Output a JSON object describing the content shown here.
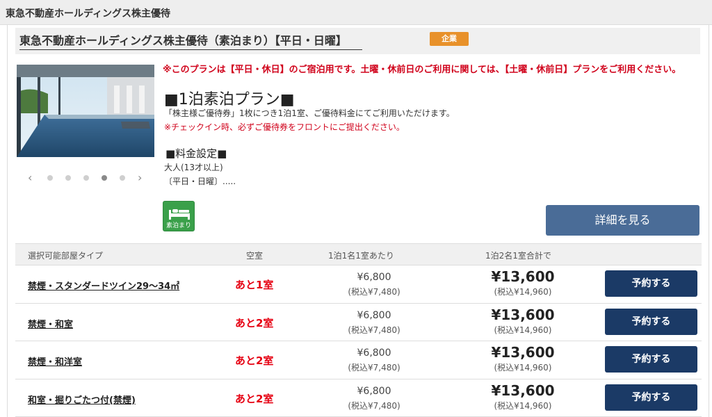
{
  "header": {
    "title": "東急不動産ホールディングス株主優待"
  },
  "plan": {
    "title": "東急不動産ホールディングス株主優待（素泊まり）【平日・日曜】",
    "badge": "企業",
    "notice": "※このプランは【平日・休日】のご宿泊用です。土曜・休前日のご利用に関しては、【土曜・休前日】プランをご利用ください。",
    "name": "■1泊素泊プラン■",
    "desc_line1": "「株主様ご優待券」1枚につき1泊1室、ご優待料金にてご利用いただけます。",
    "desc_line2": "※チェックイン時、必ずご優待券をフロントにご提出ください。",
    "price_heading": "■料金設定■",
    "adult": "大人(13才以上)",
    "days": "〔平日・日曜〕.....",
    "room_only_label": "素泊まり",
    "detail_button": "詳細を見る",
    "carousel": {
      "total": 5,
      "active": 4
    }
  },
  "rooms": {
    "headers": {
      "type": "選択可能部屋タイプ",
      "availability": "空室",
      "per_person": "1泊1名1室あたり",
      "total": "1泊2名1室合計で"
    },
    "rows": [
      {
        "name": "禁煙・スタンダードツイン29～34㎡",
        "availability": "あと1室",
        "price": "¥6,800",
        "price_tax": "(税込¥7,480)",
        "total": "¥13,600",
        "total_tax": "(税込¥14,960)",
        "book": "予約する"
      },
      {
        "name": "禁煙・和室",
        "availability": "あと2室",
        "price": "¥6,800",
        "price_tax": "(税込¥7,480)",
        "total": "¥13,600",
        "total_tax": "(税込¥14,960)",
        "book": "予約する"
      },
      {
        "name": "禁煙・和洋室",
        "availability": "あと2室",
        "price": "¥6,800",
        "price_tax": "(税込¥7,480)",
        "total": "¥13,600",
        "total_tax": "(税込¥14,960)",
        "book": "予約する"
      },
      {
        "name": "和室・掘りごたつ付(禁煙)",
        "availability": "あと2室",
        "price": "¥6,800",
        "price_tax": "(税込¥7,480)",
        "total": "¥13,600",
        "total_tax": "(税込¥14,960)",
        "book": "予約する"
      }
    ]
  },
  "colors": {
    "badge": "#e8912a",
    "alert_red": "#d0021b",
    "detail_button": "#4a6c97",
    "book_button": "#1b3a66",
    "room_only_icon": "#3aa04a"
  },
  "icons": {
    "prev": "chevron-left-icon",
    "next": "chevron-right-icon",
    "room_only": "bed-icon"
  }
}
